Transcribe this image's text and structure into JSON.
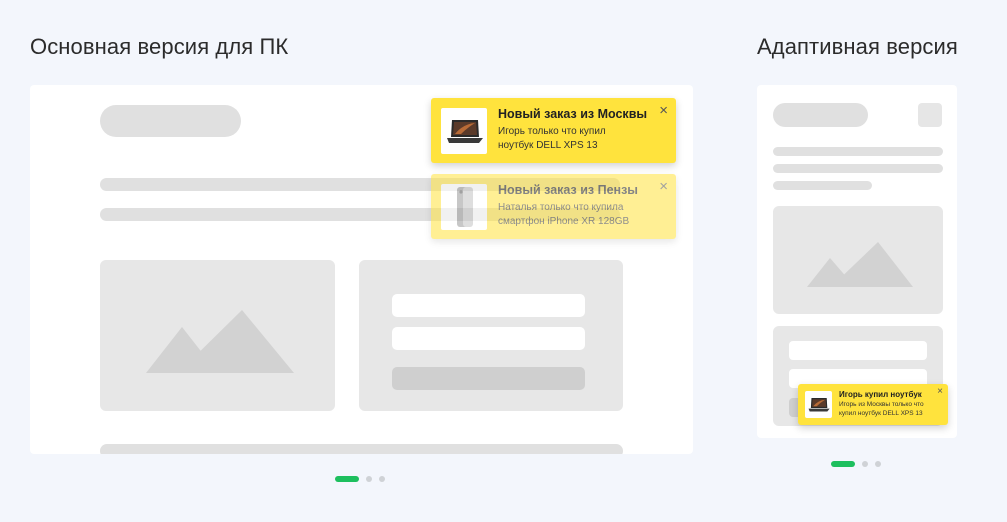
{
  "headings": {
    "desktop": "Основная версия для ПК",
    "mobile": "Адаптивная версия"
  },
  "desktop": {
    "notifications": [
      {
        "title": "Новый заказ из Москвы",
        "line1": "Игорь только что купил",
        "line2": "ноутбук DELL XPS 13",
        "close": "×",
        "thumb_icon": "laptop-icon"
      },
      {
        "title": "Новый заказ из Пензы",
        "line1": "Наталья только что купила",
        "line2": "смартфон iPhone XR 128GB",
        "close": "×",
        "thumb_icon": "phone-icon"
      }
    ]
  },
  "mobile": {
    "notification": {
      "title": "Игорь купил ноутбук",
      "line1": "Игорь из Москвы только что",
      "line2": "купил ноутбук DELL XPS 13",
      "close": "×",
      "thumb_icon": "laptop-icon"
    }
  },
  "carousel": {
    "desktop_active_slide": 1,
    "desktop_total_slides": 3,
    "mobile_active_slide": 1,
    "mobile_total_slides": 3
  },
  "colors": {
    "background": "#f3f6fc",
    "notification": "#ffe33d",
    "placeholder": "#e0e0e0",
    "accent": "#1dbf5e"
  }
}
